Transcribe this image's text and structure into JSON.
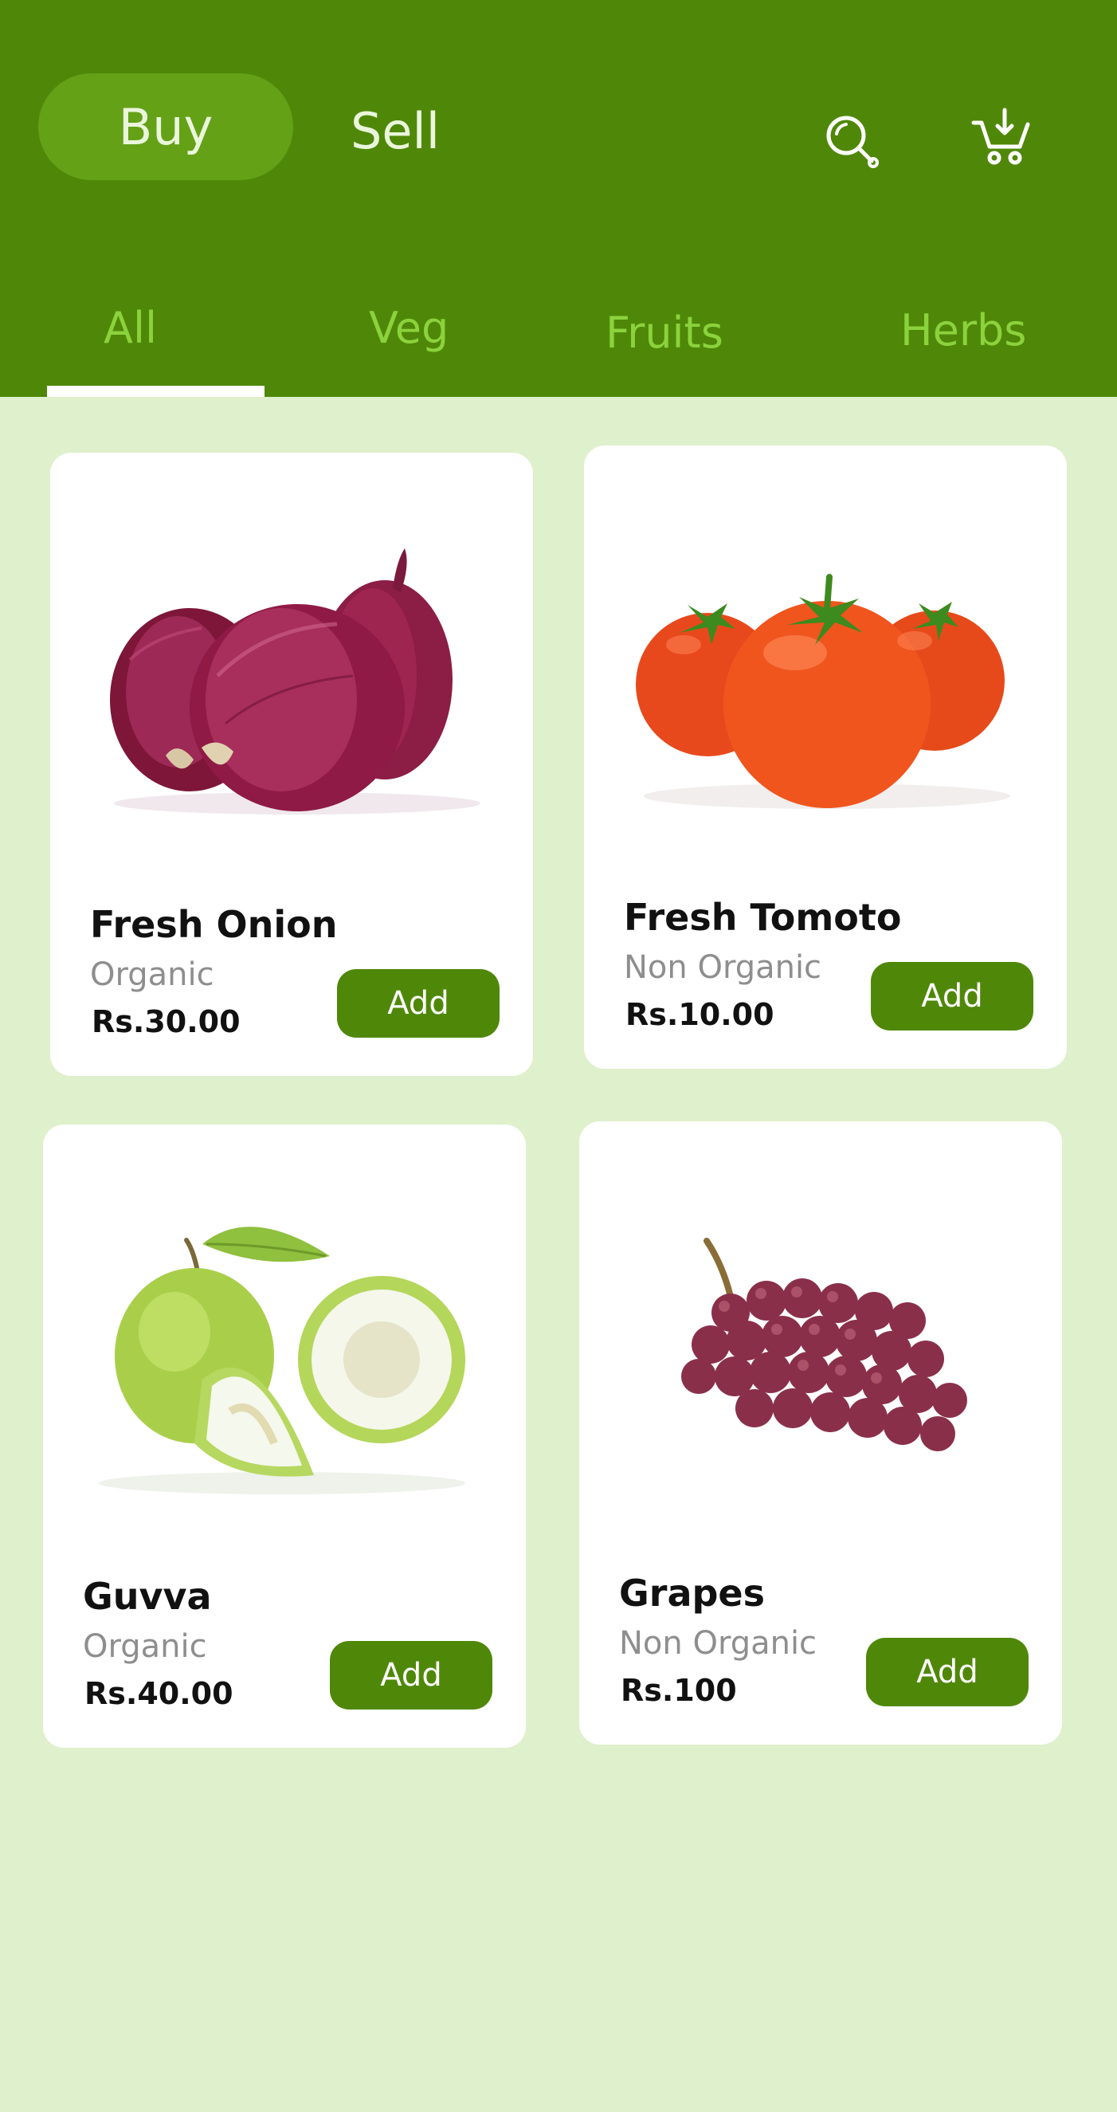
{
  "header": {
    "buy_label": "Buy",
    "sell_label": "Sell",
    "search_icon": "search-icon",
    "cart_icon": "cart-icon"
  },
  "tabs": [
    {
      "label": "All",
      "active": true
    },
    {
      "label": "Veg",
      "active": false
    },
    {
      "label": "Fruits",
      "active": false
    },
    {
      "label": "Herbs",
      "active": false
    }
  ],
  "products": [
    {
      "name": "Fresh Onion",
      "type": "Organic",
      "price": "Rs.30.00",
      "button": "Add",
      "image": "onion"
    },
    {
      "name": "Fresh Tomoto",
      "type": "Non Organic",
      "price": "Rs.10.00",
      "button": "Add",
      "image": "tomato"
    },
    {
      "name": "Guvva",
      "type": "Organic",
      "price": "Rs.40.00",
      "button": "Add",
      "image": "guava"
    },
    {
      "name": "Grapes",
      "type": "Non Organic",
      "price": "Rs.100",
      "button": "Add",
      "image": "grapes"
    }
  ],
  "colors": {
    "header_bg": "#4f8808",
    "pill_bg": "#64a117",
    "tab_text": "#8bd23c",
    "page_bg": "#dff0cc",
    "button_bg": "#4f8808"
  }
}
